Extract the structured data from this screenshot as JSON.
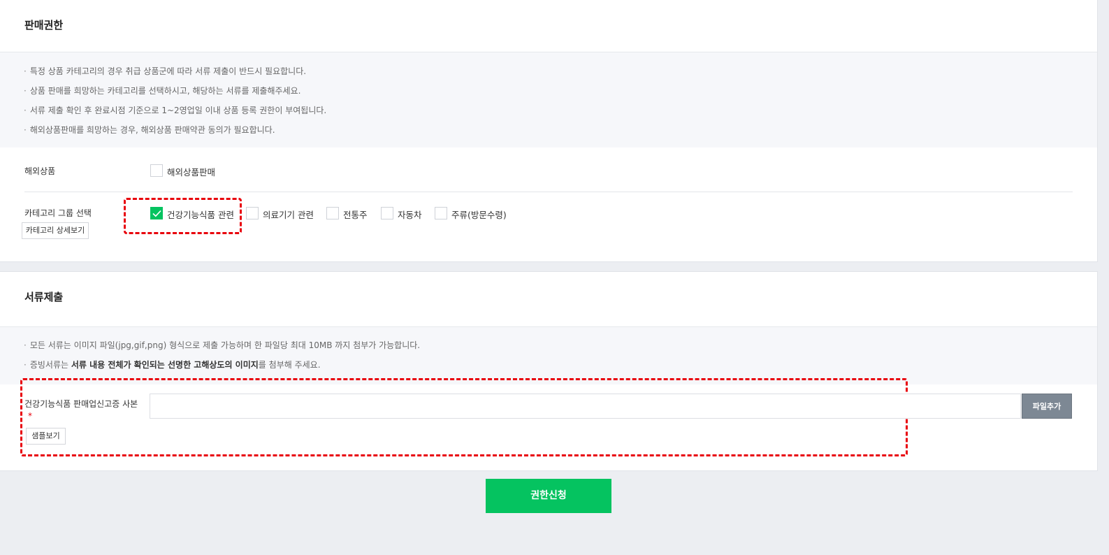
{
  "sales_permission": {
    "title": "판매권한",
    "notices": [
      "특정 상품 카테고리의 경우 취급 상품군에 따라 서류 제출이 반드시 필요합니다.",
      "상품 판매를 희망하는 카테고리를 선택하시고, 해당하는 서류를 제출해주세요.",
      "서류 제출 확인 후 완료시점 기준으로 1~2영업일 이내 상품 등록 권한이 부여됩니다.",
      "해외상품판매를 희망하는 경우, 해외상품 판매약관 동의가 필요합니다."
    ],
    "overseas": {
      "label": "해외상품",
      "checkbox_label": "해외상품판매",
      "checked": false
    },
    "category_group": {
      "label": "카테고리 그룹 선택",
      "detail_button": "카테고리 상세보기",
      "options": [
        {
          "label": "건강기능식품 관련",
          "checked": true
        },
        {
          "label": "의료기기 관련",
          "checked": false
        },
        {
          "label": "전통주",
          "checked": false
        },
        {
          "label": "자동차",
          "checked": false
        },
        {
          "label": "주류(방문수령)",
          "checked": false
        }
      ]
    }
  },
  "documents": {
    "title": "서류제출",
    "notice_1": "모든 서류는 이미지 파일(jpg,gif,png) 형식으로 제출 가능하며 한 파일당 최대 10MB 까지 첨부가 가능합니다.",
    "notice_2_prefix": "증빙서류는 ",
    "notice_2_bold": "서류 내용 전체가 확인되는 선명한 고해상도의 이미지",
    "notice_2_suffix": "를 첨부해 주세요.",
    "field_label": "건강기능식품 판매업신고증 사본",
    "required_mark": "*",
    "sample_button": "샘플보기",
    "file_value": "",
    "add_file_button": "파일추가"
  },
  "submit_button": "권한신청",
  "colors": {
    "accent": "#05c360",
    "highlight_dash": "#e8000b",
    "file_button": "#7d8894"
  }
}
